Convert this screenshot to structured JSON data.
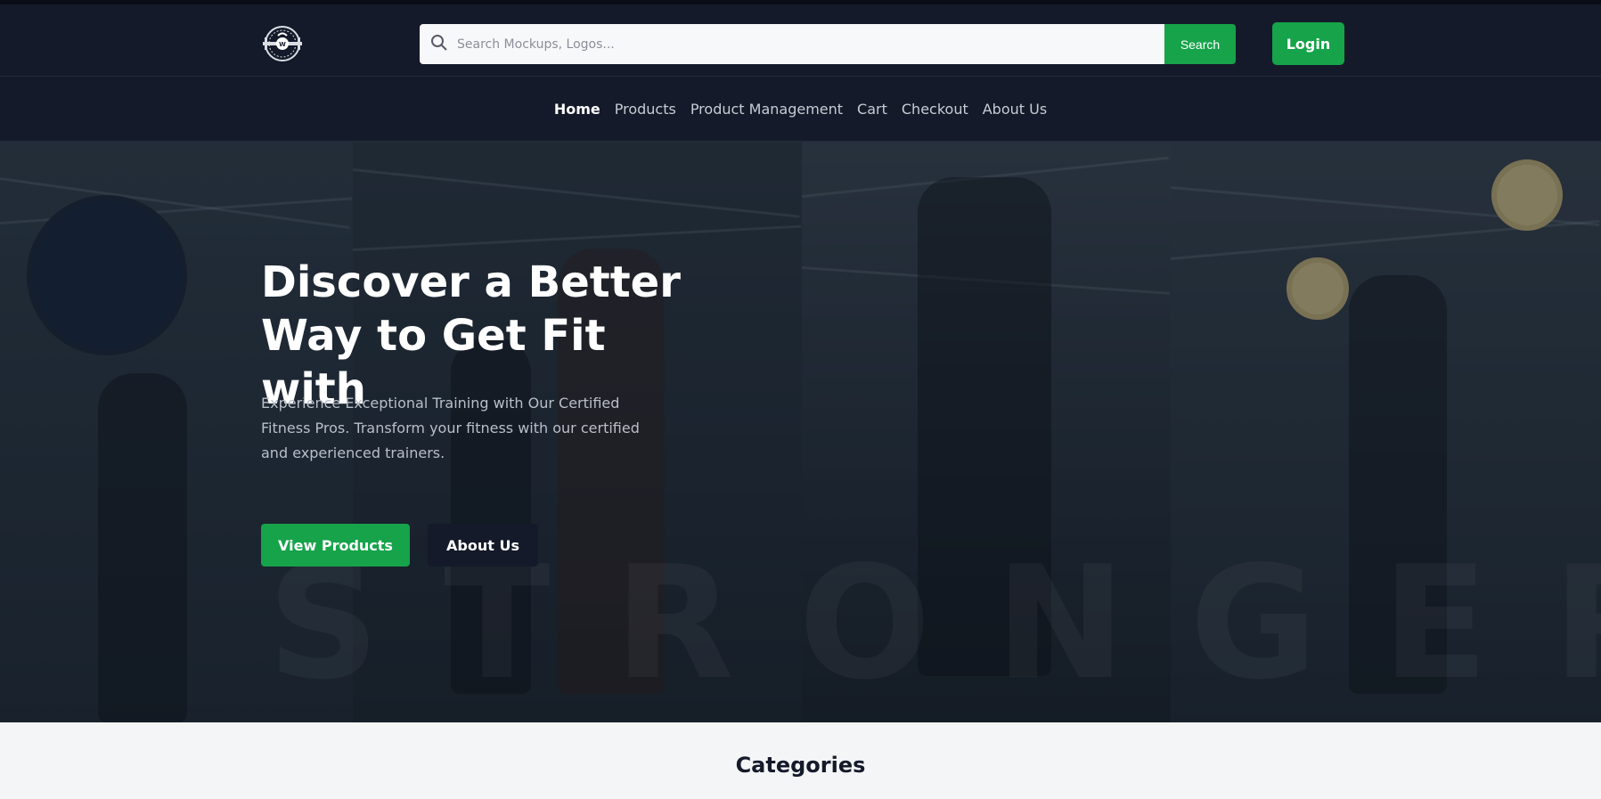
{
  "header": {
    "logo_icon": "kettlebell-crest-logo",
    "search": {
      "placeholder": "Search Mockups, Logos...",
      "value": "",
      "icon": "search-icon",
      "button_label": "Search"
    },
    "login_label": "Login"
  },
  "nav": {
    "items": [
      {
        "label": "Home",
        "active": true
      },
      {
        "label": "Products",
        "active": false
      },
      {
        "label": "Product Management",
        "active": false
      },
      {
        "label": "Cart",
        "active": false
      },
      {
        "label": "Checkout",
        "active": false
      },
      {
        "label": "About Us",
        "active": false
      }
    ]
  },
  "hero": {
    "title": "Discover a Better Way to Get Fit with",
    "description": "Experience Exceptional Training with Our Certified Fitness Pros. Transform your fitness with our certified and experienced trainers.",
    "primary_button": "View Products",
    "secondary_button": "About Us",
    "watermark": "STRONGER"
  },
  "categories": {
    "title": "Categories"
  },
  "colors": {
    "brand_dark": "#141a2a",
    "accent_green": "#16a34a",
    "page_bg": "#f4f5f7"
  }
}
